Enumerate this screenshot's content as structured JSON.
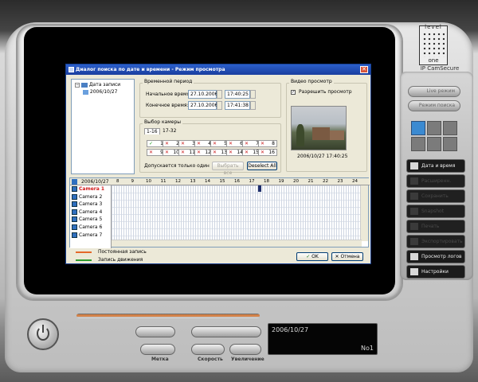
{
  "brand": {
    "line1": "level",
    "line2": "one",
    "product": "IP CamSecure"
  },
  "dialog": {
    "title": "Диалог поиска по дате и времени - Режим просмотра",
    "close": "✕",
    "tree": {
      "root": "Дата записи",
      "child": "2006/10/27"
    },
    "time_period": {
      "group": "Временной период",
      "start_label": "Начальное время:",
      "start_date": "27.10.2006",
      "start_time": "17:40:25",
      "end_label": "Конечное время:",
      "end_date": "27.10.2006",
      "end_time": "17:41:38"
    },
    "camera_select": {
      "group": "Выбор камеры",
      "tabs": [
        "1-16",
        "17-32"
      ],
      "row1": [
        "1",
        "2",
        "3",
        "4",
        "5",
        "6",
        "7",
        "8"
      ],
      "row2": [
        "9",
        "10",
        "11",
        "12",
        "13",
        "14",
        "15",
        "16"
      ],
      "only_one": "Допускается только один",
      "select_all": "Выбрать все",
      "deselect_all": "Deselect All"
    },
    "video_preview": {
      "group": "Видео просмотр",
      "allow_label": "Разрешить просмотр",
      "timestamp": "2006/10/27 17:40:25"
    },
    "timeline": {
      "date": "2006/10/27",
      "hours": [
        "8",
        "9",
        "10",
        "11",
        "12",
        "13",
        "14",
        "15",
        "16",
        "17",
        "18",
        "19",
        "20",
        "21",
        "22",
        "23",
        "24"
      ],
      "cameras": [
        "Camera 1",
        "Camera 2",
        "Camera 3",
        "Camera 4",
        "Camera 5",
        "Camera 6",
        "Camera 7"
      ]
    },
    "legend": {
      "continuous": "Постоянная запись",
      "motion": "Запись движения"
    },
    "ok": "OK",
    "cancel": "Отмена",
    "colors": {
      "continuous": "#e4682a",
      "motion": "#2e9a2e",
      "active_camera": "#d11a1a"
    }
  },
  "right_panel": {
    "btn_top1": "Live режим",
    "btn_top2": "Режим поиска",
    "menu": [
      {
        "label": "Дата и время",
        "enabled": true
      },
      {
        "label": "Расширенн.",
        "enabled": false
      },
      {
        "label": "Сохранить видео",
        "enabled": false
      },
      {
        "label": "Snapshot",
        "enabled": false
      },
      {
        "label": "Печать",
        "enabled": false
      },
      {
        "label": "Экспортировать",
        "enabled": false
      },
      {
        "label": "Просмотр логов",
        "enabled": true
      },
      {
        "label": "Настройки",
        "enabled": true
      }
    ]
  },
  "bottom": {
    "mark_label": "Метка",
    "speed_label": "Скорость",
    "zoom_label": "Увеличение",
    "display_date": "2006/10/27",
    "display_no": "No1"
  }
}
